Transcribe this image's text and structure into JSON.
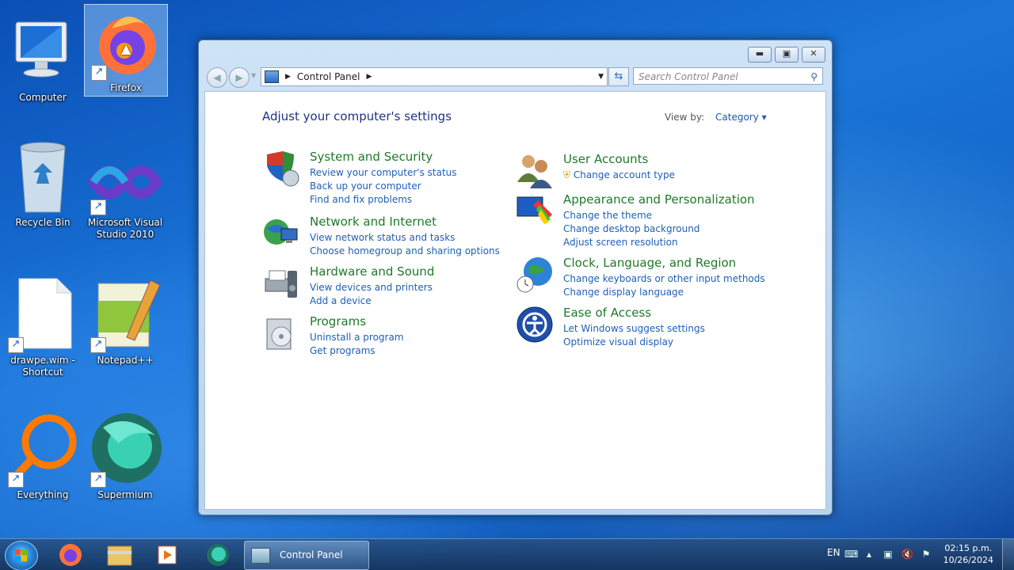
{
  "desktop": {
    "icons": [
      {
        "label": "Computer"
      },
      {
        "label": "Firefox"
      },
      {
        "label": "Recycle Bin"
      },
      {
        "label": "Microsoft Visual Studio 2010"
      },
      {
        "label": "drawpe.wim - Shortcut"
      },
      {
        "label": "Notepad++"
      },
      {
        "label": "Everything"
      },
      {
        "label": "Supermium"
      }
    ]
  },
  "window": {
    "address": {
      "location": "Control Panel"
    },
    "search_placeholder": "Search Control Panel",
    "heading": "Adjust your computer's settings",
    "view_by_label": "View by:",
    "view_by_value": "Category",
    "groups": [
      {
        "title": "System and Security",
        "icon": "shield-icon",
        "links": [
          "Review your computer's status",
          "Back up your computer",
          "Find and fix problems"
        ]
      },
      {
        "title": "Network and Internet",
        "icon": "network-globe-icon",
        "links": [
          "View network status and tasks",
          "Choose homegroup and sharing options"
        ]
      },
      {
        "title": "Hardware and Sound",
        "icon": "printer-speaker-icon",
        "links": [
          "View devices and printers",
          "Add a device"
        ]
      },
      {
        "title": "Programs",
        "icon": "programs-disk-icon",
        "links": [
          "Uninstall a program",
          "Get programs"
        ]
      },
      {
        "title": "User Accounts",
        "icon": "users-icon",
        "links": [
          "Change account type"
        ]
      },
      {
        "title": "Appearance and Personalization",
        "icon": "monitor-colors-icon",
        "links": [
          "Change the theme",
          "Change desktop background",
          "Adjust screen resolution"
        ]
      },
      {
        "title": "Clock, Language, and Region",
        "icon": "globe-clock-icon",
        "links": [
          "Change keyboards or other input methods",
          "Change display language"
        ]
      },
      {
        "title": "Ease of Access",
        "icon": "ease-of-access-icon",
        "links": [
          "Let Windows suggest settings",
          "Optimize visual display"
        ]
      }
    ]
  },
  "taskbar": {
    "active_window_label": "Control Panel",
    "language": "EN",
    "time": "02:15 p.m.",
    "date": "10/26/2024"
  }
}
